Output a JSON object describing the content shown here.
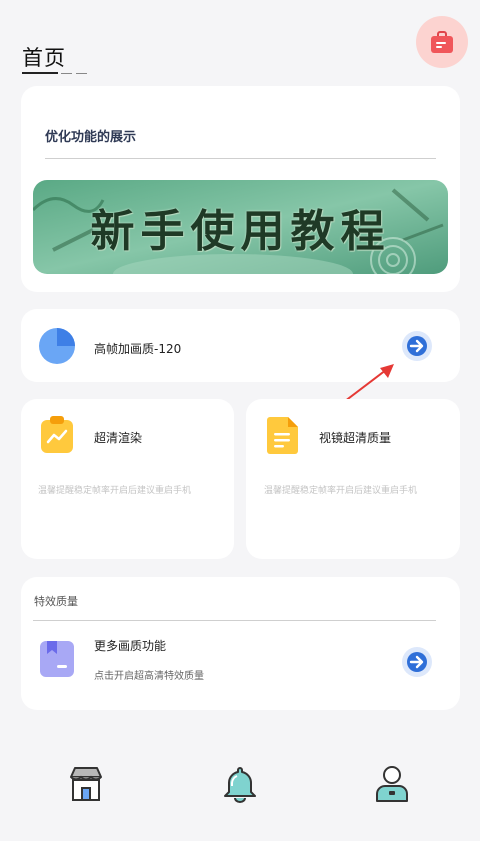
{
  "header": {
    "title": "首页",
    "bag_icon": "shopping-bag-icon",
    "accent_bg": "#fcd3d0",
    "accent": "#f0565a"
  },
  "showcase": {
    "title": "优化功能的展示",
    "banner_text": "新手使用教程"
  },
  "quality_row": {
    "label": "高帧加画质-120",
    "icon": "pie-chart-icon",
    "action_icon": "arrow-right-icon"
  },
  "features": [
    {
      "label": "超清渲染",
      "desc": "温馨提醒稳定帧率开启后建议重启手机",
      "icon": "chart-clipboard-icon"
    },
    {
      "label": "视镜超清质量",
      "desc": "温馨提醒稳定帧率开启后建议重启手机",
      "icon": "document-icon"
    }
  ],
  "effects": {
    "section_title": "特效质量",
    "item_label": "更多画质功能",
    "item_desc": "点击开启超高清特效质量",
    "icon": "bookmark-icon",
    "action_icon": "arrow-right-icon"
  },
  "nav": [
    {
      "icon": "store-icon"
    },
    {
      "icon": "bell-icon"
    },
    {
      "icon": "user-icon"
    }
  ]
}
